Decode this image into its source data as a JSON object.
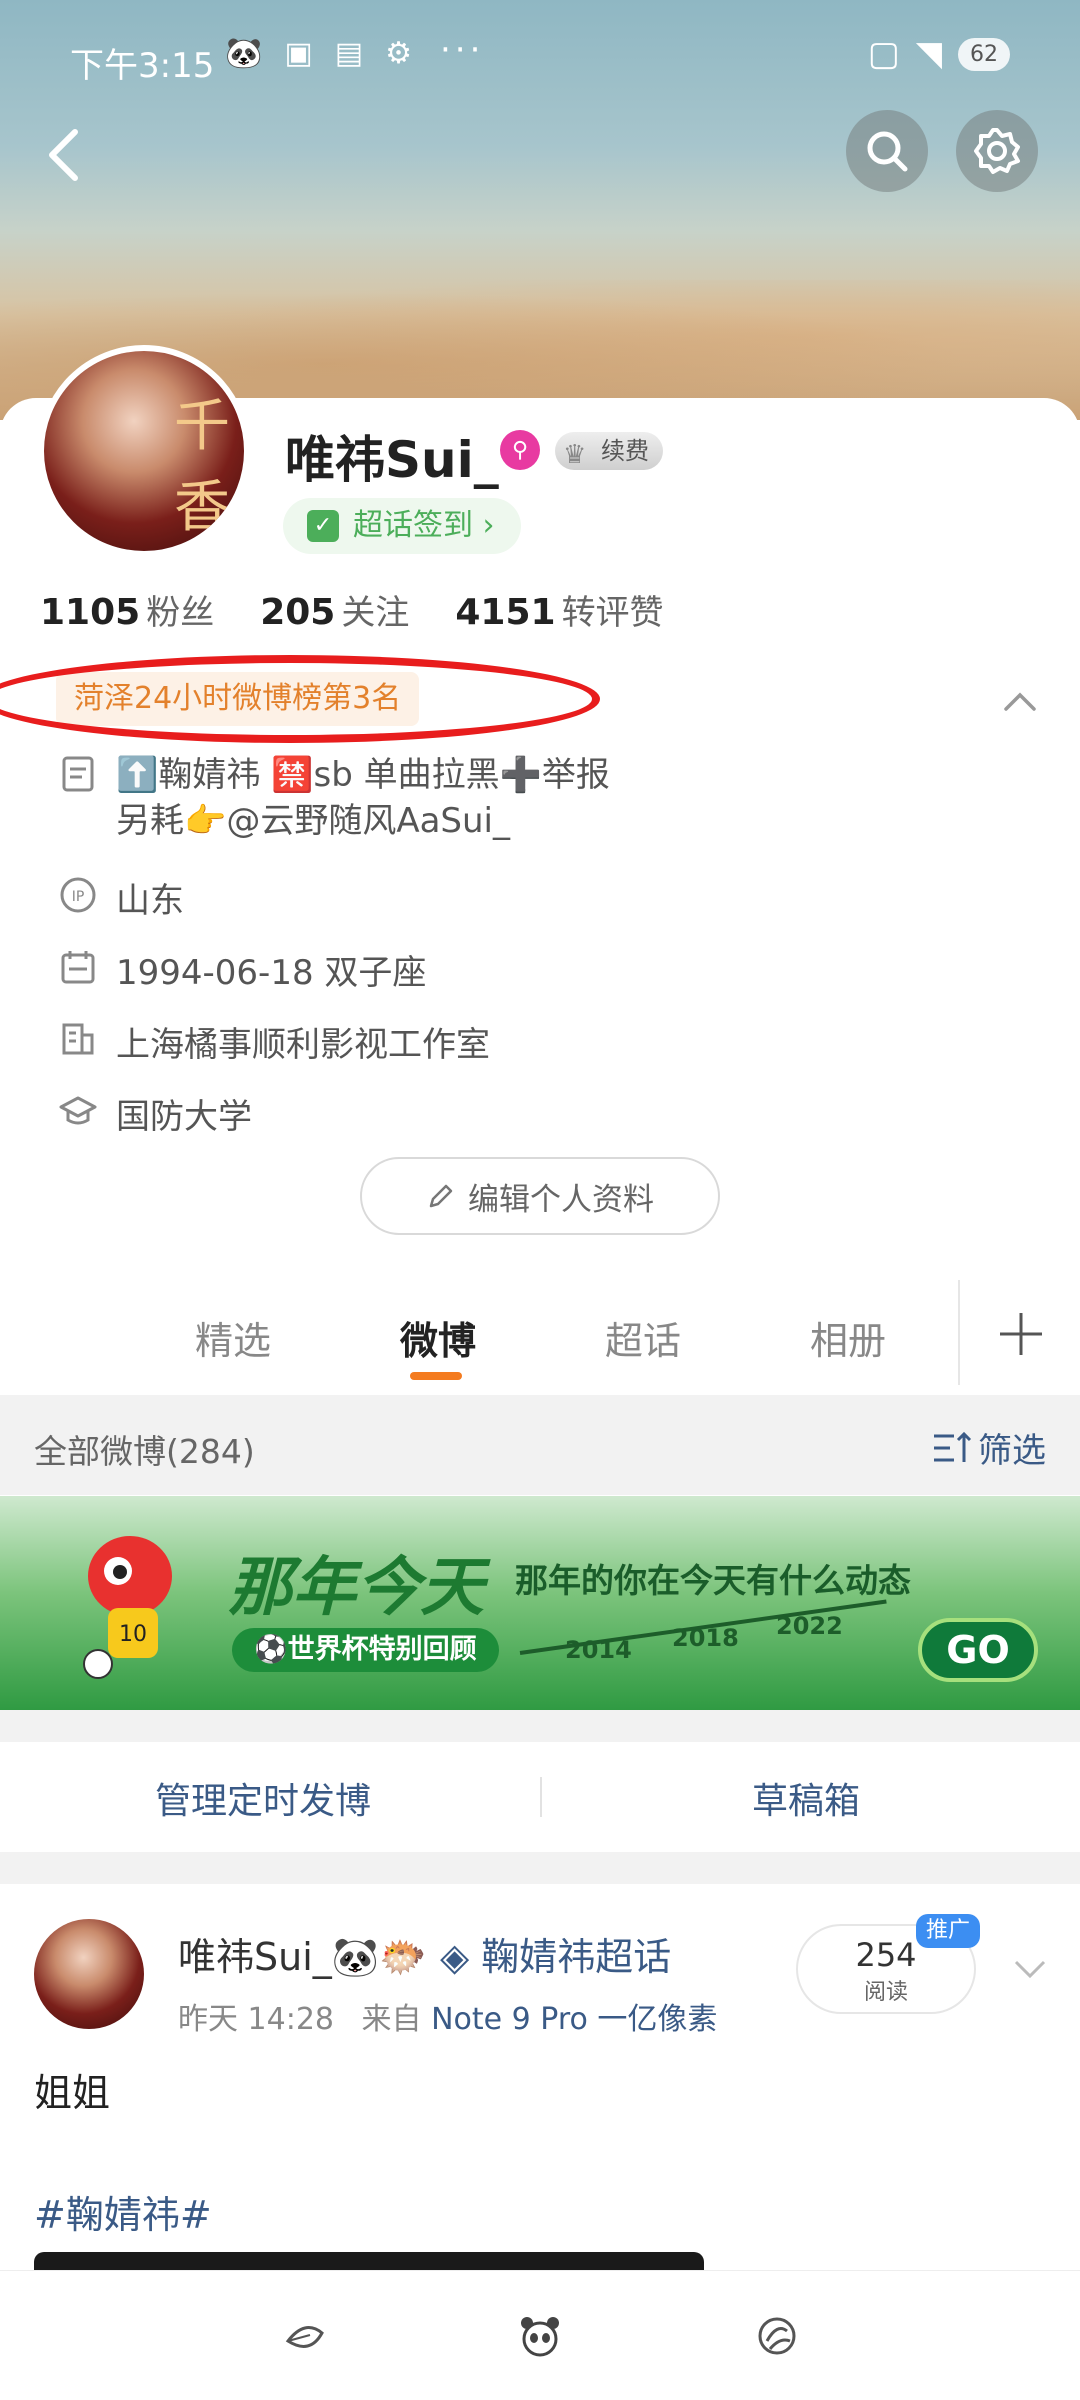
{
  "status_bar": {
    "time": "下午3:15",
    "battery": "62",
    "more": "···"
  },
  "header": {
    "back_icon": "chevron-left-icon",
    "search_icon": "search-icon",
    "settings_icon": "gear-icon"
  },
  "profile": {
    "username": "唯祎Sui_",
    "renew_label": "续费",
    "checkin_label": "超话签到",
    "checkin_arrow": "›",
    "stats": [
      {
        "num": "1105",
        "label": "粉丝"
      },
      {
        "num": "205",
        "label": "关注"
      },
      {
        "num": "4151",
        "label": "转评赞"
      }
    ],
    "rank_tag": "菏泽24小时微博榜第3名",
    "bio_line1": "⬆️鞠婧祎 🈲sb  单曲拉黑➕举报",
    "bio_line2": "另耗👉@云野随风AaSui_",
    "ip": "山东",
    "birthday": "1994-06-18 双子座",
    "company": "上海橘事顺利影视工作室",
    "school": "国防大学",
    "edit_button": "编辑个人资料"
  },
  "tabs": [
    {
      "label": "精选"
    },
    {
      "label": "微博"
    },
    {
      "label": "超话"
    },
    {
      "label": "相册"
    }
  ],
  "filter_bar": {
    "title": "全部微博(284)",
    "filter_label": "筛选"
  },
  "promo": {
    "title": "那年今天",
    "subtitle": "那年的你在今天有什么动态",
    "pill": "⚽世界杯特别回顾",
    "years": [
      "2014",
      "2018",
      "2022"
    ],
    "go": "GO"
  },
  "actions": {
    "scheduled": "管理定时发博",
    "drafts": "草稿箱"
  },
  "post": {
    "author": "唯祎Sui_🐼🐡",
    "topic": "◈ 鞠婧祎超话",
    "time": "昨天 14:28",
    "source_prefix": "来自",
    "source": "Note 9 Pro 一亿像素",
    "read_count": "254",
    "read_label": "阅读",
    "promo_tag": "推广",
    "body": "姐姐",
    "hashtag": "#鞠婧祎#"
  },
  "avatar_poster_text": "千香",
  "colors": {
    "accent_orange": "#f47b1f",
    "link_blue": "#3a5a86",
    "annotation_red": "#e81d1d",
    "checkin_green": "#4cae5a"
  }
}
